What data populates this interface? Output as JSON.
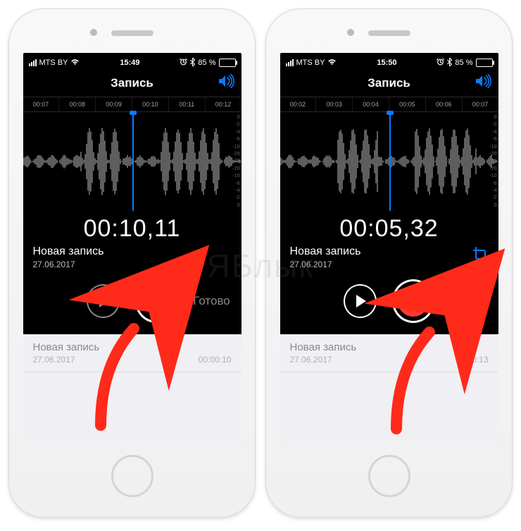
{
  "watermark": "ЯБлык",
  "phones": [
    {
      "status": {
        "carrier": "MTS BY",
        "network": "wifi",
        "time": "15:49",
        "alarm": true,
        "bluetooth": true,
        "battery_pct": "85 %"
      },
      "nav": {
        "title": "Запись"
      },
      "timeline": [
        "00:07",
        "00:08",
        "00:09",
        "00:10",
        "00:11",
        "00:12"
      ],
      "scale": [
        "0",
        "-2",
        "-4",
        "-6",
        "-10",
        "-20",
        "-30",
        "-20",
        "-10",
        "-6",
        "-4",
        "-2",
        "0"
      ],
      "elapsed": "00:10,11",
      "recording": {
        "title": "Новая запись",
        "date": "27.06.2017"
      },
      "controls": {
        "done_label": "Готово",
        "play_enabled": false,
        "mode": "stop",
        "done_enabled": false,
        "show_crop": false
      },
      "list": [
        {
          "title": "Новая запись",
          "date": "27.06.2017",
          "duration": "00:00:10"
        }
      ],
      "arrow_target": "record"
    },
    {
      "status": {
        "carrier": "MTS BY",
        "network": "wifi",
        "time": "15:50",
        "alarm": true,
        "bluetooth": true,
        "battery_pct": "85 %"
      },
      "nav": {
        "title": "Запись"
      },
      "timeline": [
        "00:02",
        "00:03",
        "00:04",
        "00:05",
        "00:06",
        "00:07"
      ],
      "scale": [
        "0",
        "-2",
        "-4",
        "-6",
        "-10",
        "-20",
        "-30",
        "-20",
        "-10",
        "-6",
        "-4",
        "-2",
        "0"
      ],
      "elapsed": "00:05,32",
      "recording": {
        "title": "Новая запись",
        "date": "27.06.2017"
      },
      "controls": {
        "done_label": "Готово",
        "play_enabled": true,
        "mode": "record",
        "done_enabled": true,
        "show_crop": true
      },
      "list": [
        {
          "title": "Новая запись",
          "date": "27.06.2017",
          "duration": "00:00:13"
        }
      ],
      "arrow_target": "done"
    }
  ]
}
